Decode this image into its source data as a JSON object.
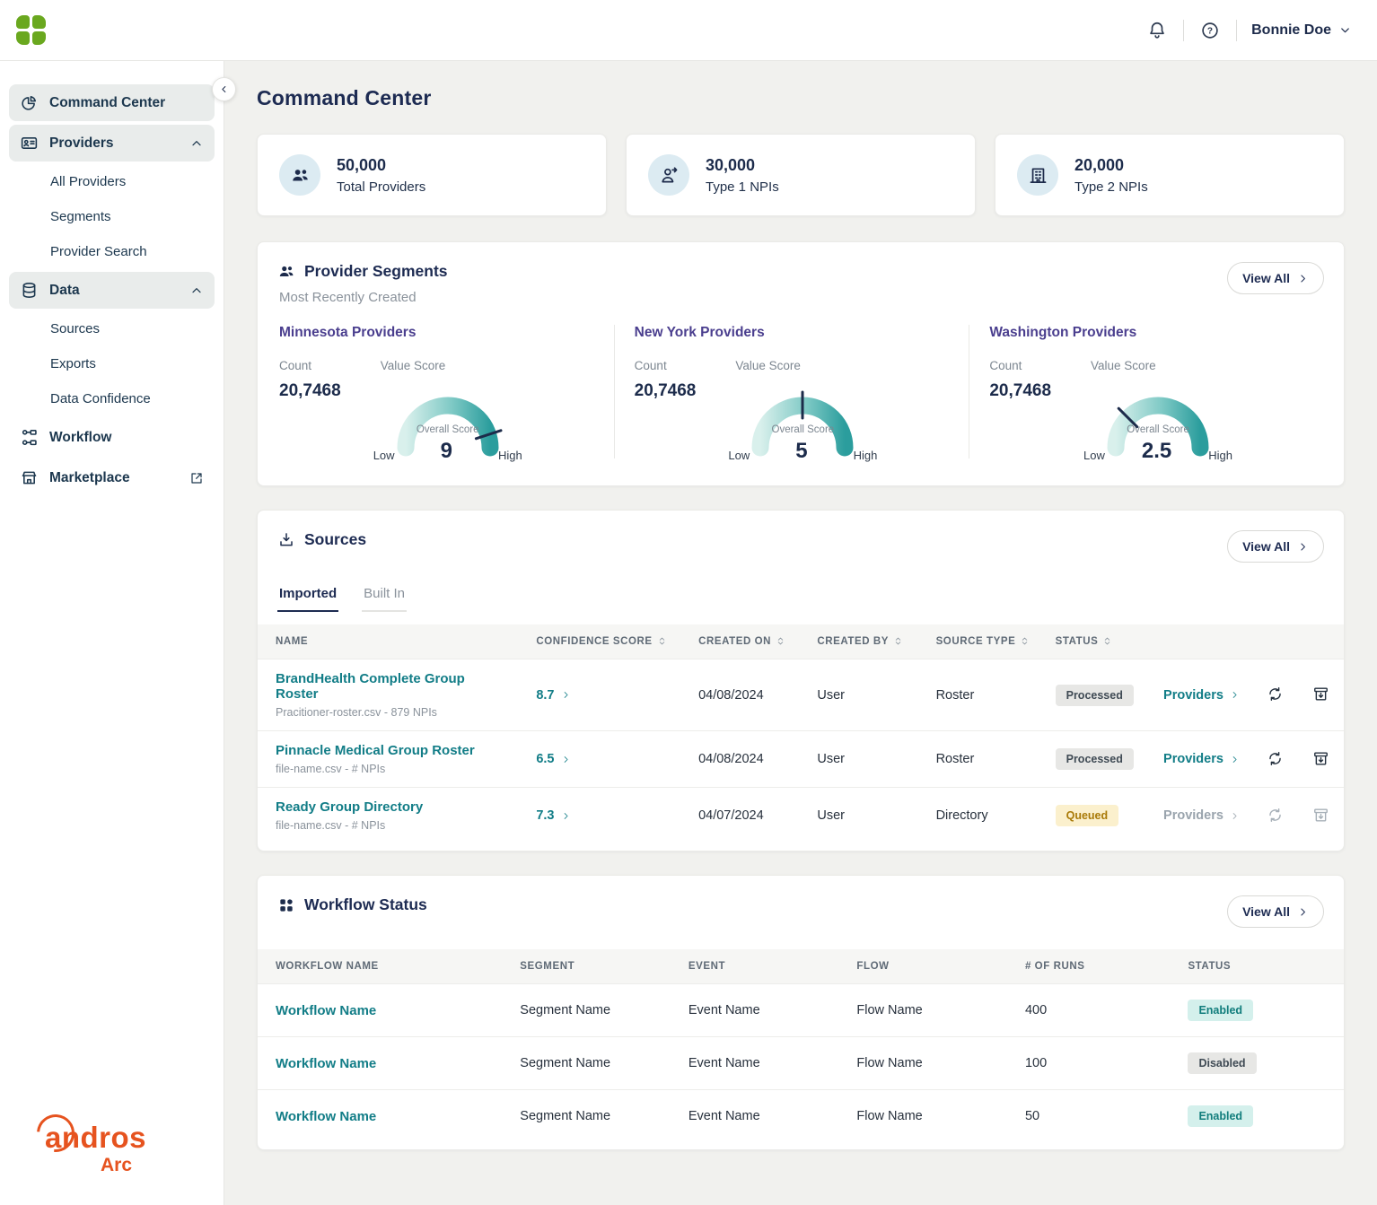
{
  "colors": {
    "brand_green": "#6aa81f",
    "accent_teal": "#127d87",
    "navy": "#1d2b52",
    "segment_purple": "#4a3e8e",
    "logo_orange": "#e6531f",
    "badge_queued_bg": "#fbf0cd",
    "badge_enabled_bg": "#d4f0ec",
    "badge_gray_bg": "#e7e7e5"
  },
  "topbar": {
    "user_name": "Bonnie Doe"
  },
  "sidebar": {
    "command_center": "Command Center",
    "providers": "Providers",
    "all_providers": "All Providers",
    "segments": "Segments",
    "provider_search": "Provider Search",
    "data": "Data",
    "sources": "Sources",
    "exports": "Exports",
    "data_confidence": "Data Confidence",
    "workflow": "Workflow",
    "marketplace": "Marketplace",
    "logo_text": "andros",
    "logo_sub": "Arc"
  },
  "page": {
    "title": "Command Center"
  },
  "stats": [
    {
      "value": "50,000",
      "label": "Total Providers"
    },
    {
      "value": "30,000",
      "label": "Type 1 NPIs"
    },
    {
      "value": "20,000",
      "label": "Type 2 NPIs"
    }
  ],
  "segments_card": {
    "title": "Provider Segments",
    "subtitle": "Most Recently Created",
    "view_all": "View All",
    "count_label": "Count",
    "value_score_label": "Value Score",
    "overall_score_label": "Overall Score",
    "low": "Low",
    "high": "High",
    "items": [
      {
        "name": "Minnesota Providers",
        "count": "20,7468",
        "score": "9",
        "score_value": 9
      },
      {
        "name": "New York Providers",
        "count": "20,7468",
        "score": "5",
        "score_value": 5
      },
      {
        "name": "Washington Providers",
        "count": "20,7468",
        "score": "2.5",
        "score_value": 2.5
      }
    ]
  },
  "sources_card": {
    "title": "Sources",
    "view_all": "View All",
    "tabs": {
      "imported": "Imported",
      "built_in": "Built In"
    },
    "columns": {
      "name": "NAME",
      "confidence": "CONFIDENCE SCORE",
      "created_on": "CREATED ON",
      "created_by": "CREATED BY",
      "source_type": "SOURCE TYPE",
      "status": "STATUS"
    },
    "rows": [
      {
        "name": "BrandHealth Complete Group Roster",
        "file": "Pracitioner-roster.csv - 879 NPIs",
        "score": "8.7",
        "created_on": "04/08/2024",
        "created_by": "User",
        "source_type": "Roster",
        "status": "Processed",
        "status_variant": "processed",
        "providers": "Providers",
        "state": "active"
      },
      {
        "name": "Pinnacle Medical Group Roster",
        "file": "file-name.csv - # NPIs",
        "score": "6.5",
        "created_on": "04/08/2024",
        "created_by": "User",
        "source_type": "Roster",
        "status": "Processed",
        "status_variant": "processed",
        "providers": "Providers",
        "state": "active"
      },
      {
        "name": "Ready Group Directory",
        "file": "file-name.csv - # NPIs",
        "score": "7.3",
        "created_on": "04/07/2024",
        "created_by": "User",
        "source_type": "Directory",
        "status": "Queued",
        "status_variant": "queued",
        "providers": "Providers",
        "state": "queued"
      }
    ]
  },
  "workflow_card": {
    "title": "Workflow Status",
    "view_all": "View All",
    "columns": {
      "name": "WORKFLOW NAME",
      "segment": "SEGMENT",
      "event": "EVENT",
      "flow": "FLOW",
      "runs": "# OF RUNS",
      "status": "STATUS"
    },
    "rows": [
      {
        "name": "Workflow Name",
        "segment": "Segment Name",
        "event": "Event Name",
        "flow": "Flow Name",
        "runs": "400",
        "status": "Enabled",
        "status_variant": "enabled"
      },
      {
        "name": "Workflow Name",
        "segment": "Segment Name",
        "event": "Event Name",
        "flow": "Flow Name",
        "runs": "100",
        "status": "Disabled",
        "status_variant": "disabled"
      },
      {
        "name": "Workflow Name",
        "segment": "Segment Name",
        "event": "Event Name",
        "flow": "Flow Name",
        "runs": "50",
        "status": "Enabled",
        "status_variant": "enabled"
      }
    ]
  }
}
